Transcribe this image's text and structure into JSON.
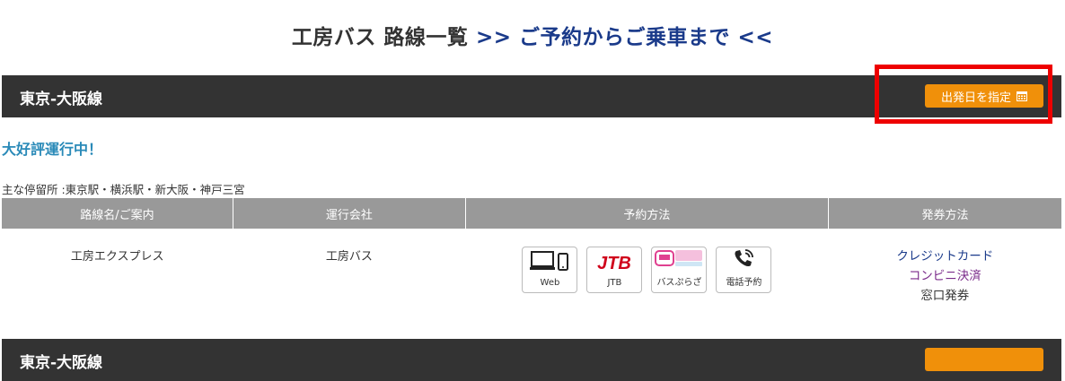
{
  "title": {
    "main": "工房バス 路線一覧",
    "link": ">> ご予約からご乗車まで <<"
  },
  "route1": {
    "name": "東京-大阪線",
    "date_button": "出発日を指定",
    "status": "大好評運行中！",
    "stops": "主な停留所 :東京駅・横浜駅・新大阪・神戸三宮",
    "table": {
      "headers": [
        "路線名/ご案内",
        "運行会社",
        "予約方法",
        "発券方法"
      ],
      "route_name": "工房エクスプレス",
      "operator": "工房バス",
      "reservation_methods": [
        {
          "label": "Web",
          "icon": "computer-phone-icon"
        },
        {
          "label": "JTB",
          "icon": "jtb-logo-icon"
        },
        {
          "label": "バスぷらざ",
          "icon": "bus-plaza-logo-icon"
        },
        {
          "label": "電話予約",
          "icon": "phone-icon"
        }
      ],
      "issuance": [
        "クレジットカード",
        "コンビニ決済",
        "窓口発券"
      ]
    }
  },
  "route2": {
    "name": "東京-大阪線"
  },
  "colors": {
    "header_bg": "#333333",
    "accent_orange": "#f0900a",
    "status_blue": "#2a8ab8",
    "link_navy": "#1a3a8a",
    "highlight_red": "#ee0000"
  }
}
